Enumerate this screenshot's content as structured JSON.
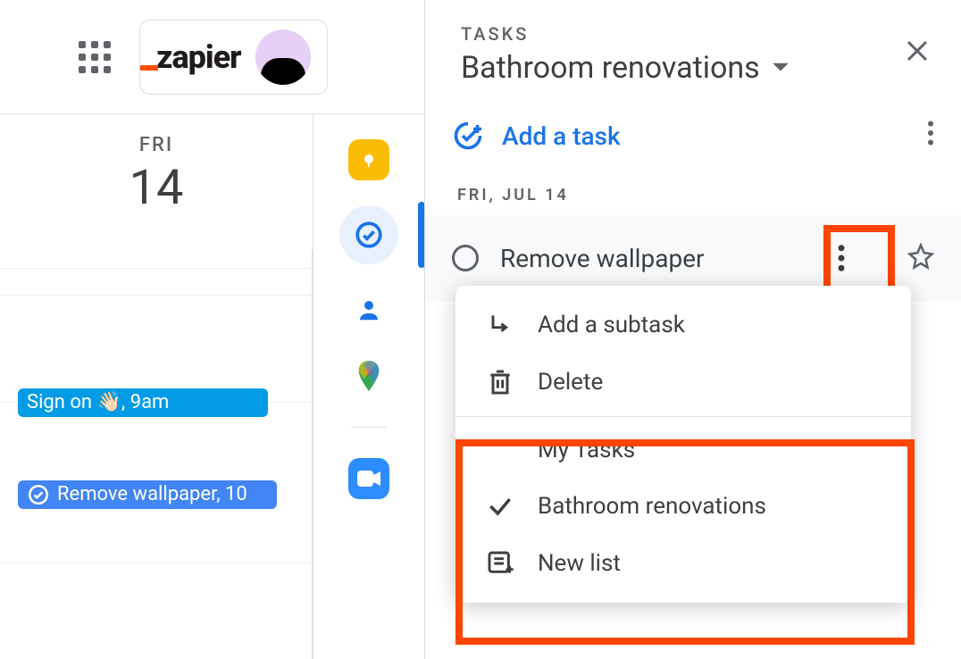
{
  "top": {
    "brand": "zapier"
  },
  "calendar": {
    "day": "FRI",
    "date": "14",
    "events": [
      {
        "title": "Sign on 👋🏻, 9am"
      },
      {
        "title": "Remove wallpaper, 10"
      }
    ]
  },
  "tasks_panel": {
    "label": "TASKS",
    "list_name": "Bathroom renovations",
    "add_label": "Add a task",
    "date_header": "FRI, JUL 14",
    "task": {
      "title": "Remove wallpaper"
    }
  },
  "menu": {
    "add_subtask": "Add a subtask",
    "delete": "Delete",
    "my_tasks": "My Tasks",
    "bathroom": "Bathroom renovations",
    "new_list": "New list"
  }
}
